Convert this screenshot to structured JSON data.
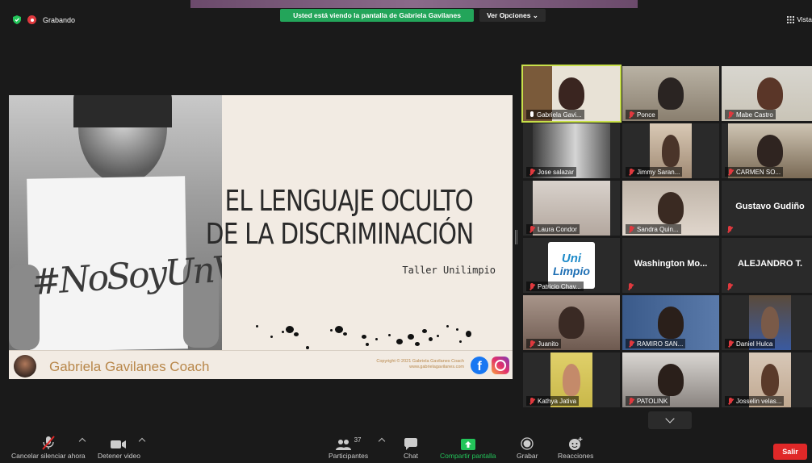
{
  "recording": {
    "label": "Grabando"
  },
  "banner": {
    "text": "Usted está viendo la pantalla de Gabriela Gavilanes",
    "view_options": "Ver Opciones ⌄"
  },
  "view": {
    "label": "Vista"
  },
  "slide": {
    "title_line1": "EL LENGUAJE OCULTO",
    "title_line2": "DE LA DISCRIMINACIÓN",
    "subtitle": "Taller Unilimpio",
    "sign_text": "#NoSoyUnVIRUS",
    "coach_name": "Gabriela Gavilanes Coach",
    "copyright_line1": "Copyright © 2021 Gabriela Gavilanes Coach",
    "copyright_line2": "www.gabrielagavilanes.com"
  },
  "participants_tiles": [
    {
      "name": "Gabriela Gavi..."
    },
    {
      "name": "Ponce"
    },
    {
      "name": "Mabe Castro"
    },
    {
      "name": "Jose salazar"
    },
    {
      "name": "Jimmy Saran..."
    },
    {
      "name": "CARMEN SO..."
    },
    {
      "name": "Laura Condor"
    },
    {
      "name": "Sandra Quin..."
    },
    {
      "name": "Gustavo Gudiño"
    },
    {
      "name": "Patricio Chav..."
    },
    {
      "name": "Washington  Mo..."
    },
    {
      "name": "ALEJANDRO T."
    },
    {
      "name": "Juanito"
    },
    {
      "name": "RAMIRO SAN..."
    },
    {
      "name": "Daniel Hulca"
    },
    {
      "name": "Kathya Jativa"
    },
    {
      "name": "PATOLINK"
    },
    {
      "name": "Josselin velas..."
    }
  ],
  "logo": {
    "line1": "Uni",
    "line2": "Limpio"
  },
  "toolbar": {
    "unmute": "Cancelar silenciar ahora",
    "stop_video": "Detener video",
    "participants": "Participantes",
    "participants_count": "37",
    "chat": "Chat",
    "share": "Compartir pantalla",
    "record": "Grabar",
    "reactions": "Reacciones",
    "exit": "Salir"
  },
  "colors": {
    "banner_green": "#23a55a",
    "share_green": "#23c55a",
    "exit_red": "#e02828",
    "active_border": "#c8e04a"
  }
}
